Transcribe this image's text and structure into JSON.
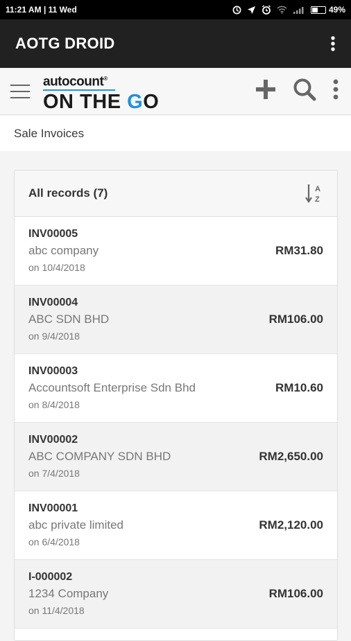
{
  "status_bar": {
    "time": "11:21 AM",
    "separator": "|",
    "date": "11 Wed",
    "battery": "49%",
    "battery_level": 0.49
  },
  "window": {
    "title": "AOTG DROID"
  },
  "app_bar": {
    "logo_brand": "autocount",
    "logo_reg": "®",
    "logo_tag_start": "ON THE ",
    "logo_tag_g": "G",
    "logo_tag_end": "O"
  },
  "page": {
    "title": "Sale Invoices"
  },
  "list": {
    "header": "All records (7)",
    "records": [
      {
        "code": "INV00005",
        "customer": "abc company",
        "date": "on 10/4/2018",
        "amount": "RM31.80"
      },
      {
        "code": "INV00004",
        "customer": "ABC SDN BHD",
        "date": "on 9/4/2018",
        "amount": "RM106.00"
      },
      {
        "code": "INV00003",
        "customer": "Accountsoft Enterprise Sdn Bhd",
        "date": "on 8/4/2018",
        "amount": "RM10.60"
      },
      {
        "code": "INV00002",
        "customer": "ABC COMPANY SDN BHD",
        "date": "on 7/4/2018",
        "amount": "RM2,650.00"
      },
      {
        "code": "INV00001",
        "customer": "abc private limited",
        "date": "on 6/4/2018",
        "amount": "RM2,120.00"
      },
      {
        "code": "I-000002",
        "customer": "1234 Company",
        "date": "on 11/4/2018",
        "amount": "RM106.00"
      }
    ]
  },
  "icons": [
    "sync-icon",
    "location-icon",
    "alarm-icon",
    "wifi-icon",
    "signal-icon",
    "battery-icon",
    "overflow-menu-icon",
    "hamburger-menu-icon",
    "add-icon",
    "search-icon",
    "sort-alpha-icon"
  ],
  "colors": {
    "title_bar": "#212121",
    "brand_blue": "#1e90e0",
    "status_bar": "#000000"
  }
}
